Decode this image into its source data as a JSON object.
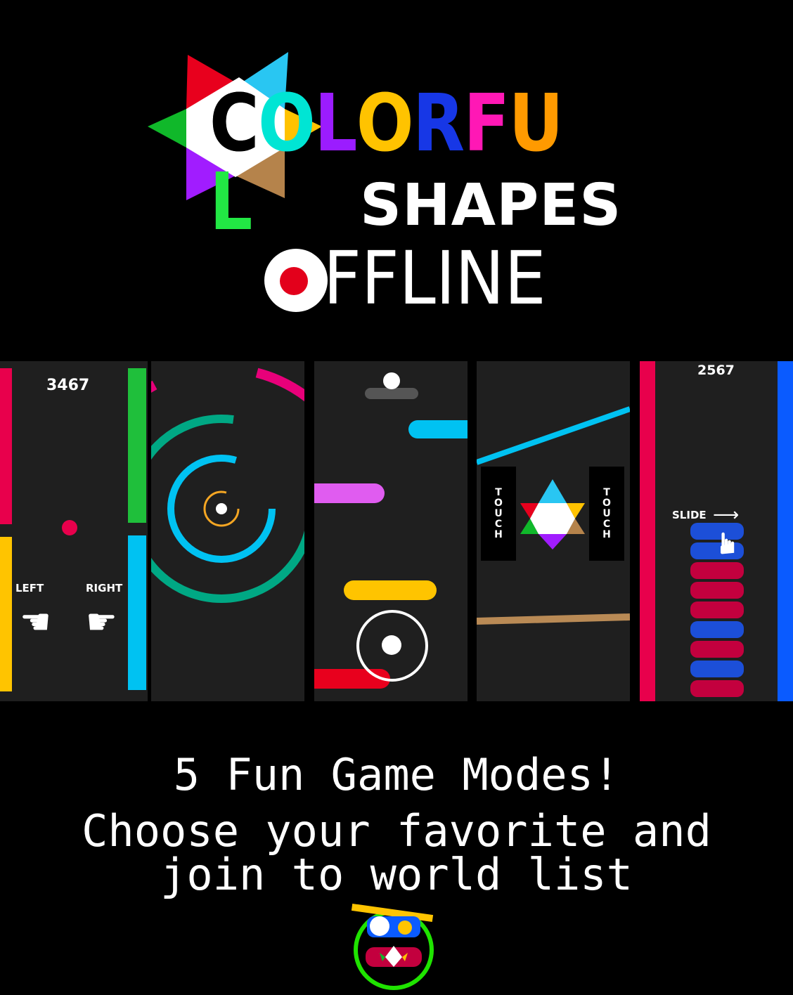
{
  "title": {
    "letters": [
      {
        "ch": "C",
        "color": "#000000"
      },
      {
        "ch": "O",
        "color": "#00e5d4"
      },
      {
        "ch": "L",
        "color": "#9b1cff"
      },
      {
        "ch": "O",
        "color": "#ffc300"
      },
      {
        "ch": "R",
        "color": "#1737e6"
      },
      {
        "ch": "F",
        "color": "#ff18b5"
      },
      {
        "ch": "U",
        "color": "#ff9a00"
      },
      {
        "ch": "L",
        "color": "#22e844"
      }
    ],
    "line2": "SHAPES",
    "line3": "FFLINE"
  },
  "panels": {
    "p1": {
      "score": "3467",
      "left": "LEFT",
      "right": "RIGHT"
    },
    "p4": {
      "touch_left": "TOUCH",
      "touch_right": "TOUCH"
    },
    "p5": {
      "score": "2567",
      "slide": "SLIDE"
    }
  },
  "tagline": {
    "line1": "5 Fun Game Modes!",
    "line2": "Choose your favorite and",
    "line3": "join to world list"
  },
  "colors": {
    "red": "#e8004c",
    "green": "#1fbf3b",
    "yellow": "#ffc400",
    "cyan": "#00c2f2",
    "teal": "#00a884",
    "pink": "#e8007a",
    "magenta": "#e05cf0",
    "brown": "#b98a55",
    "blue": "#0a5bff",
    "orange": "#f5a623"
  },
  "icons": [
    "star-logo-icon",
    "offline-dot-icon",
    "pointing-hand-icon",
    "arrow-right-icon",
    "app-icon"
  ]
}
